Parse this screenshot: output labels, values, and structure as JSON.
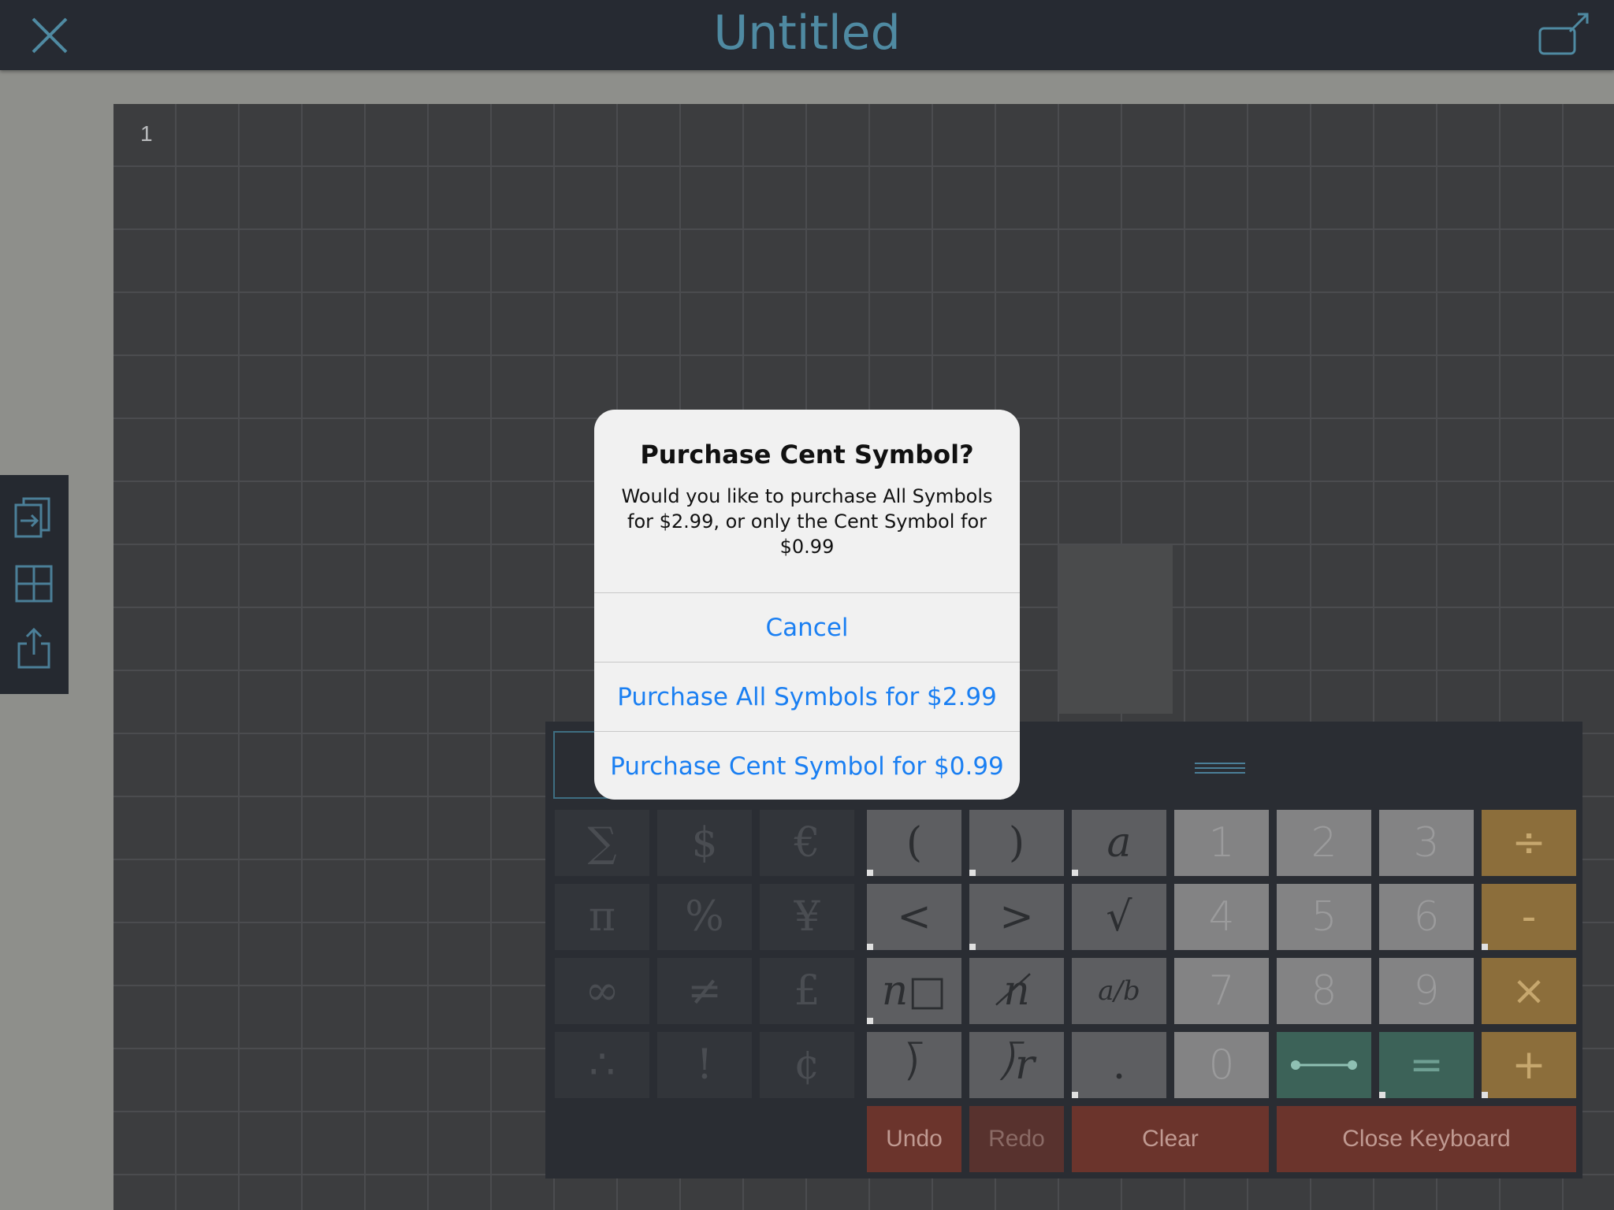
{
  "topbar": {
    "title": "Untitled",
    "close_icon": "close-x-icon",
    "open_icon": "open-external-icon"
  },
  "sheet": {
    "page_number": "1"
  },
  "side_toolbar": {
    "items": [
      {
        "icon": "copy-page-icon"
      },
      {
        "icon": "grid-layout-icon"
      },
      {
        "icon": "share-icon"
      }
    ]
  },
  "keyboard": {
    "symbol_keys": [
      "∑",
      "$",
      "€",
      "π",
      "%",
      "¥",
      "∞",
      "≠",
      "£",
      "∴",
      "!",
      "¢"
    ],
    "operator_keys": [
      "(",
      ")",
      "a",
      "<",
      ">",
      "√",
      "n□",
      "n̸",
      "a/b",
      "⟌",
      "⟌r",
      "."
    ],
    "number_keys": [
      "1",
      "2",
      "3",
      "4",
      "5",
      "6",
      "7",
      "8",
      "9",
      "0"
    ],
    "math_keys": [
      "÷",
      "-",
      "×",
      "+"
    ],
    "special_keys": {
      "line": "⟷",
      "equals": "="
    },
    "action_keys": {
      "undo": "Undo",
      "redo": "Redo",
      "clear": "Clear",
      "close": "Close Keyboard"
    },
    "colors": {
      "gold": "#8c6e3b",
      "green": "#3c6258",
      "red": "#6b342c"
    }
  },
  "alert": {
    "title": "Purchase Cent Symbol?",
    "message": "Would you like to purchase All Symbols for $2.99, or only the Cent Symbol for $0.99",
    "cancel": "Cancel",
    "purchase_all": "Purchase All Symbols for $2.99",
    "purchase_cent": "Purchase Cent Symbol for $0.99",
    "button_color": "#1a7ff2"
  }
}
